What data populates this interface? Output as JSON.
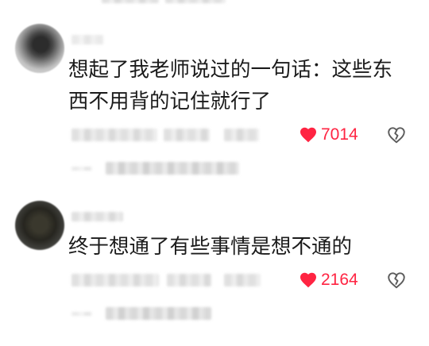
{
  "comments": [
    {
      "text": "想起了我老师说过的一句话：这些东西不用背的记住就行了",
      "likes": "7014",
      "liked": true,
      "like_icon": "heart-icon",
      "dislike_icon": "broken-heart-icon"
    },
    {
      "text": "终于想通了有些事情是想不通的",
      "likes": "2164",
      "liked": true,
      "like_icon": "heart-icon",
      "dislike_icon": "broken-heart-icon"
    }
  ],
  "colors": {
    "like": "#ff2442",
    "text": "#1b1b1b",
    "icon": "#5c5c5c"
  }
}
